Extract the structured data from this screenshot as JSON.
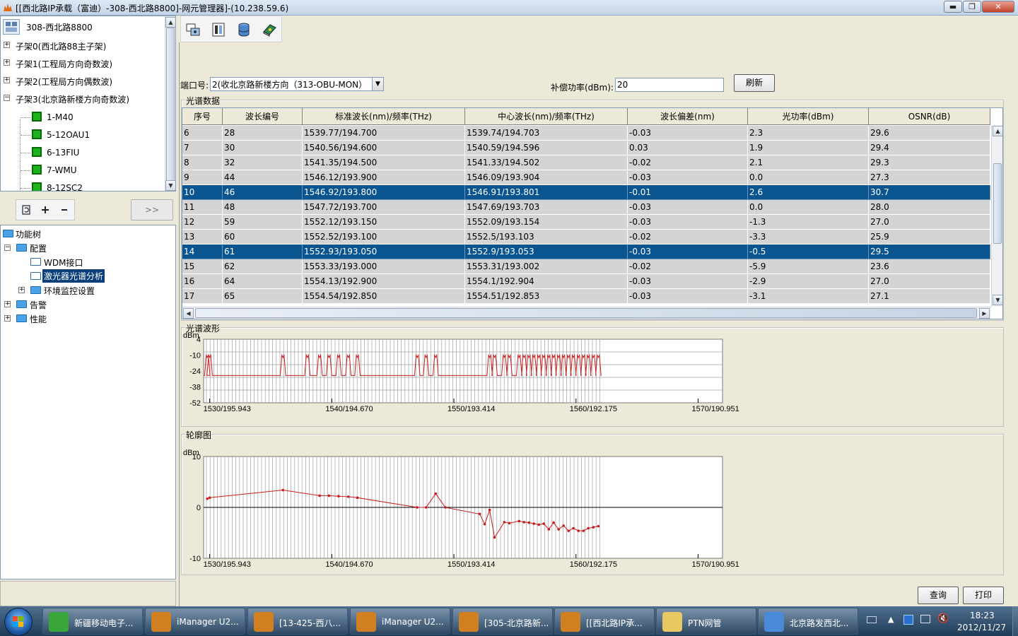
{
  "window": {
    "title": "[[西北路IP承载（富迪）-308-西北路8800]-网元管理器]-(10.238.59.6)",
    "min": "▬",
    "max": "❐",
    "close": "✕"
  },
  "ne_tree": {
    "root": "308-西北路8800",
    "items": [
      {
        "label": "子架0(西北路88主子架)",
        "exp": "+"
      },
      {
        "label": "子架1(工程局方向奇数波)",
        "exp": "+"
      },
      {
        "label": "子架2(工程局方向偶数波)",
        "exp": "+"
      },
      {
        "label": "子架3(北京路新楼方向奇数波)",
        "exp": "−"
      }
    ],
    "boards": [
      "1-M40",
      "5-12OAU1",
      "6-13FIU",
      "7-WMU",
      "8-12SC2"
    ]
  },
  "left_tools": {
    "expand_label": ">>"
  },
  "func_tree": {
    "root": "功能树",
    "config": "配置",
    "wdm": "WDM接口",
    "laser": "激光器光谱分析",
    "env": "环境监控设置",
    "alarm": "告警",
    "perf": "性能",
    "exp_minus": "−",
    "exp_plus": "+"
  },
  "controls": {
    "port_label": "端口号:",
    "port_value": "2(收北京路新楼方向（313-OBU-MON）",
    "comp_label": "补偿功率(dBm):",
    "comp_value": "20",
    "refresh": "刷新"
  },
  "spectrum_data": {
    "group_label": "光谱数据",
    "columns": [
      "序号",
      "波长编号",
      "标准波长(nm)/频率(THz)",
      "中心波长(nm)/频率(THz)",
      "波长偏差(nm)",
      "光功率(dBm)",
      "OSNR(dB)"
    ],
    "rows": [
      [
        "6",
        "28",
        "1539.77/194.700",
        "1539.74/194.703",
        "-0.03",
        "2.3",
        "29.6"
      ],
      [
        "7",
        "30",
        "1540.56/194.600",
        "1540.59/194.596",
        "0.03",
        "1.9",
        "29.4"
      ],
      [
        "8",
        "32",
        "1541.35/194.500",
        "1541.33/194.502",
        "-0.02",
        "2.1",
        "29.3"
      ],
      [
        "9",
        "44",
        "1546.12/193.900",
        "1546.09/193.904",
        "-0.03",
        "0.0",
        "27.3"
      ],
      [
        "10",
        "46",
        "1546.92/193.800",
        "1546.91/193.801",
        "-0.01",
        "2.6",
        "30.7"
      ],
      [
        "11",
        "48",
        "1547.72/193.700",
        "1547.69/193.703",
        "-0.03",
        "0.0",
        "28.0"
      ],
      [
        "12",
        "59",
        "1552.12/193.150",
        "1552.09/193.154",
        "-0.03",
        "-1.3",
        "27.0"
      ],
      [
        "13",
        "60",
        "1552.52/193.100",
        "1552.5/193.103",
        "-0.02",
        "-3.3",
        "25.9"
      ],
      [
        "14",
        "61",
        "1552.93/193.050",
        "1552.9/193.053",
        "-0.03",
        "-0.5",
        "29.5"
      ],
      [
        "15",
        "62",
        "1553.33/193.000",
        "1553.31/193.002",
        "-0.02",
        "-5.9",
        "23.6"
      ],
      [
        "16",
        "64",
        "1554.13/192.900",
        "1554.1/192.904",
        "-0.03",
        "-2.9",
        "27.0"
      ],
      [
        "17",
        "65",
        "1554.54/192.850",
        "1554.51/192.853",
        "-0.03",
        "-3.1",
        "27.1"
      ]
    ],
    "selected_rows": [
      4,
      8
    ]
  },
  "chart_data": [
    {
      "type": "line",
      "group_label": "光谱波形",
      "ylabel": "dBm",
      "yticks": [
        "4",
        "-10",
        "-24",
        "-38",
        "-52"
      ],
      "ylim": [
        -52,
        4
      ],
      "xticks": [
        "1530/195.943",
        "1540/194.670",
        "1550/193.414",
        "1560/192.175",
        "1570/190.951"
      ],
      "xtick_values": [
        1530,
        1540,
        1550,
        1560,
        1570
      ],
      "xunit": "nm/THz",
      "xlim": [
        1529.5,
        1572
      ],
      "baseline": -28,
      "noise_floor": -30,
      "peak_height": -12,
      "channels": [
        1529.8,
        1530.0,
        1536.0,
        1538.0,
        1539.0,
        1539.77,
        1540.56,
        1541.35,
        1542.1,
        1547.0,
        1547.72,
        1548.51,
        1552.93,
        1553.33,
        1554.13,
        1554.54,
        1555.34,
        1555.75,
        1556.15,
        1556.55,
        1556.96,
        1557.36,
        1557.77,
        1558.17,
        1558.58,
        1558.98,
        1559.39,
        1559.79,
        1560.2,
        1560.61,
        1561.01,
        1561.42,
        1561.83
      ]
    },
    {
      "type": "line",
      "group_label": "轮廓图",
      "ylabel": "dBm",
      "yticks": [
        "10",
        "0",
        "-10"
      ],
      "ylim": [
        -10,
        10
      ],
      "xticks": [
        "1530/195.943",
        "1540/194.670",
        "1550/193.414",
        "1560/192.175",
        "1570/190.951"
      ],
      "xtick_values": [
        1530,
        1540,
        1550,
        1560,
        1570
      ],
      "xunit": "nm/THz",
      "xlim": [
        1529.5,
        1572
      ],
      "points": [
        [
          1529.8,
          1.7
        ],
        [
          1530.0,
          1.9
        ],
        [
          1536.0,
          3.4
        ],
        [
          1539.0,
          2.3
        ],
        [
          1539.77,
          2.3
        ],
        [
          1540.56,
          2.2
        ],
        [
          1541.35,
          2.1
        ],
        [
          1542.1,
          1.9
        ],
        [
          1547.0,
          0.0
        ],
        [
          1547.72,
          0.0
        ],
        [
          1548.51,
          2.7
        ],
        [
          1549.3,
          0.0
        ],
        [
          1552.12,
          -1.3
        ],
        [
          1552.52,
          -3.3
        ],
        [
          1552.93,
          -0.5
        ],
        [
          1553.33,
          -5.9
        ],
        [
          1554.13,
          -2.9
        ],
        [
          1554.54,
          -3.1
        ],
        [
          1555.34,
          -2.7
        ],
        [
          1555.75,
          -2.9
        ],
        [
          1556.15,
          -3.0
        ],
        [
          1556.55,
          -3.2
        ],
        [
          1556.96,
          -3.4
        ],
        [
          1557.36,
          -3.2
        ],
        [
          1557.77,
          -4.3
        ],
        [
          1558.17,
          -3.0
        ],
        [
          1558.58,
          -4.3
        ],
        [
          1558.98,
          -3.6
        ],
        [
          1559.39,
          -4.6
        ],
        [
          1559.79,
          -4.1
        ],
        [
          1560.2,
          -4.6
        ],
        [
          1560.61,
          -4.6
        ],
        [
          1561.01,
          -4.1
        ],
        [
          1561.42,
          -3.9
        ],
        [
          1561.83,
          -3.7
        ]
      ]
    }
  ],
  "bottom_buttons": {
    "query": "查询",
    "print": "打印"
  },
  "taskbar": {
    "items": [
      {
        "label": "新疆移动电子...",
        "color": "#3aa63a"
      },
      {
        "label": "iManager U2...",
        "color": "#d08020"
      },
      {
        "label": "[13-425-西八...",
        "color": "#d08020"
      },
      {
        "label": "iManager U2...",
        "color": "#d08020"
      },
      {
        "label": "[305-北京路新...",
        "color": "#d08020"
      },
      {
        "label": "[[西北路IP承...",
        "color": "#d08020"
      },
      {
        "label": "PTN网管",
        "color": "#e8c860"
      },
      {
        "label": "北京路发西北...",
        "color": "#4a8ad8"
      }
    ],
    "time": "18:23",
    "date": "2012/11/27"
  },
  "colors": {
    "selection": "#0a5490",
    "trace": "#c81e1e",
    "grid": "#808080"
  }
}
